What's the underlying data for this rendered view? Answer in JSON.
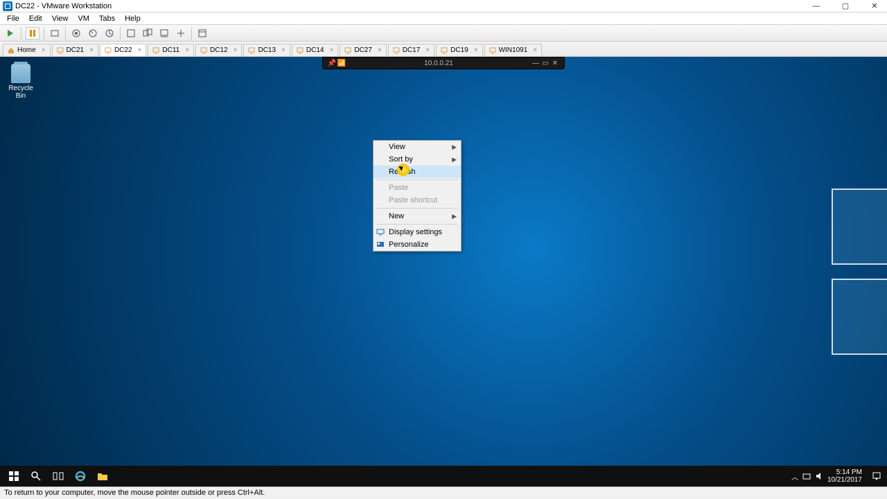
{
  "window": {
    "title": "DC22 - VMware Workstation",
    "controls": {
      "min": "—",
      "max": "▢",
      "close": "✕"
    }
  },
  "menubar": [
    "File",
    "Edit",
    "View",
    "VM",
    "Tabs",
    "Help"
  ],
  "tabs": {
    "home_label": "Home",
    "items": [
      "DC21",
      "DC22",
      "DC11",
      "DC12",
      "DC13",
      "DC14",
      "DC27",
      "DC17",
      "DC19",
      "WIN1091"
    ],
    "active_index": 1
  },
  "guest_topbar": {
    "ip": "10.0.0.21"
  },
  "desktop": {
    "recycle_bin_label": "Recycle Bin"
  },
  "context_menu": {
    "view": "View",
    "sort_by": "Sort by",
    "refresh": "Refresh",
    "paste": "Paste",
    "paste_shortcut": "Paste shortcut",
    "new": "New",
    "display_settings": "Display settings",
    "personalize": "Personalize"
  },
  "tray": {
    "time": "5:14 PM",
    "date": "10/21/2017"
  },
  "statusbar": {
    "text": "To return to your computer, move the mouse pointer outside or press Ctrl+Alt."
  }
}
